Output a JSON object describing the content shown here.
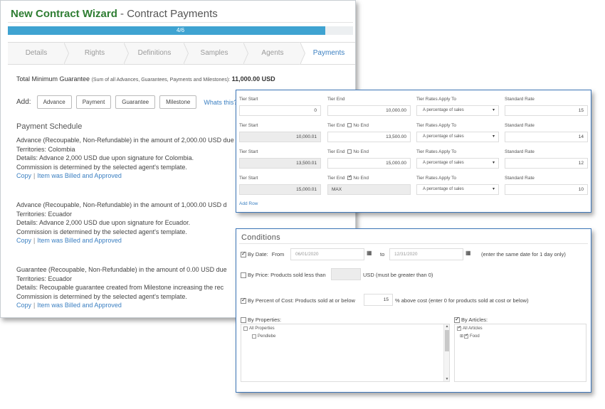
{
  "wizard": {
    "title_bold": "New Contract Wizard",
    "title_rest": " - Contract Payments",
    "progress_label": "4/6",
    "progress_value": 0.92,
    "steps": [
      "Details",
      "Rights",
      "Definitions",
      "Samples",
      "Agents",
      "Payments"
    ],
    "active_step": "Payments",
    "min_guarantee_label": "Total Minimum Guarantee",
    "min_guarantee_note": "(Sum of all Advances, Guarantees, Payments and Milestones):",
    "min_guarantee_value": "11,000.00 USD",
    "add_label": "Add:",
    "add_buttons": [
      "Advance",
      "Payment",
      "Guarantee",
      "Milestone"
    ],
    "whats_this": "Whats this?",
    "schedule_heading": "Payment Schedule",
    "entries": [
      {
        "line1": "Advance (Recoupable, Non-Refundable) in the amount of 2,000.00 USD due",
        "line2": "Territories: Colombia",
        "line3": "Details: Advance 2,000 USD due upon signature for Colombia.",
        "line4": "Commission is determined by the selected agent's template.",
        "link1": "Copy",
        "link2": "Item was Billed and Approved"
      },
      {
        "line1": "Advance (Recoupable, Non-Refundable) in the amount of 1,000.00 USD d",
        "line2": "Territories: Ecuador",
        "line3": "Details: Advance 2,000 USD due upon signature for Ecuador.",
        "line4": "Commission is determined by the selected agent's template.",
        "link1": "Copy",
        "link2": "Item was Billed and Approved"
      },
      {
        "line1": "Guarantee (Recoupable, Non-Refundable) in the amount of 0.00 USD due",
        "line2": "Territories: Ecuador",
        "line3": "Details: Recoupable guarantee created from Milestone increasing the rec",
        "line4": "Commission is determined by the selected agent's template.",
        "link1": "Copy",
        "link2": "Item was Billed and Approved"
      }
    ]
  },
  "tiers": {
    "labels": {
      "tier_start": "Tier Start",
      "tier_end": "Tier End",
      "rates_apply": "Tier Rates Apply To",
      "standard_rate": "Standard Rate",
      "no_end": "No End"
    },
    "rows": [
      {
        "start": "0",
        "end": "10,000.00",
        "apply": "A percentage of sales",
        "rate": "15",
        "no_end": false,
        "show_no_end": false
      },
      {
        "start": "10,000.01",
        "end": "13,500.00",
        "apply": "A percentage of sales",
        "rate": "14",
        "no_end": false,
        "show_no_end": true
      },
      {
        "start": "13,500.01",
        "end": "15,000.00",
        "apply": "A percentage of sales",
        "rate": "12",
        "no_end": false,
        "show_no_end": true
      },
      {
        "start": "15,000.01",
        "end": "MAX",
        "apply": "A percentage of sales",
        "rate": "10",
        "no_end": true,
        "show_no_end": true
      }
    ],
    "add_row": "Add Row"
  },
  "conditions": {
    "title": "Conditions",
    "by_date": "By Date:",
    "from_label": "From",
    "from_value": "06/01/2020",
    "to_label": "to",
    "to_value": "12/31/2020",
    "date_note": "(enter the same date for 1 day only)",
    "by_price": "By Price: Products sold less than",
    "price_value": "",
    "price_note": "USD (must be greater than 0)",
    "by_percent": "By Percent of Cost: Products sold at or below",
    "percent_value": "15",
    "percent_note": "% above cost (enter 0 for products sold at cost or below)",
    "by_properties": "By Properties:",
    "properties_tree": [
      "All Properties",
      "Pendlebe"
    ],
    "by_articles": "By Articles:",
    "articles_tree": [
      "All Articles",
      "Food"
    ]
  }
}
